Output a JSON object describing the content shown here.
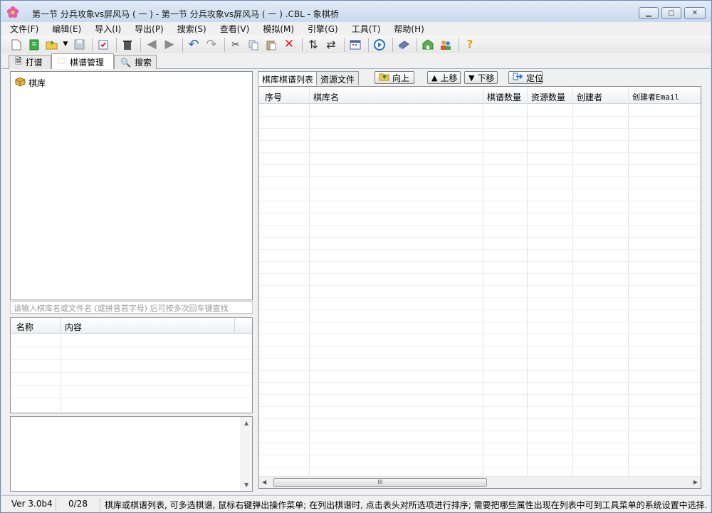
{
  "window": {
    "title": "第一节  分兵攻象vs屏风马 ( 一 )  -  第一节  分兵攻象vs屏风马 ( 一 ) .CBL - 象棋桥"
  },
  "menu": [
    "文件(F)",
    "编辑(E)",
    "导入(I)",
    "导出(P)",
    "搜索(S)",
    "查看(V)",
    "模拟(M)",
    "引擎(G)",
    "工具(T)",
    "帮助(H)"
  ],
  "main_tabs": [
    {
      "label": "打谱",
      "icon": "document-icon"
    },
    {
      "label": "棋谱管理",
      "icon": "folder-icon"
    },
    {
      "label": "搜索",
      "icon": "magnifier-icon"
    }
  ],
  "tree": {
    "root": "棋库"
  },
  "search_placeholder": "请输入棋库名或文件名 (或拼音首字母) 后可按多次回车键查找",
  "props_grid": {
    "headers": [
      "名称",
      "内容"
    ]
  },
  "sub_tabs": [
    "棋库棋谱列表",
    "资源文件"
  ],
  "nav_buttons": [
    "向上",
    "上移",
    "下移",
    "定位"
  ],
  "list": {
    "headers": [
      "序号",
      "棋库名",
      "棋谱数量",
      "资源数量",
      "创建者",
      "创建者Email"
    ]
  },
  "scroll_thumb": "III",
  "status": {
    "version": "Ver 3.0b4",
    "count": "0/28",
    "message": "棋库或棋谱列表, 可多选棋谱, 鼠标右键弹出操作菜单; 在列出棋谱时, 点击表头对所选项进行排序; 需要把哪些属性出现在列表中可到工具菜单的系统设置中选择."
  },
  "colors": {
    "frame": "#6a8bb3",
    "accent": "#1e6fd9"
  }
}
